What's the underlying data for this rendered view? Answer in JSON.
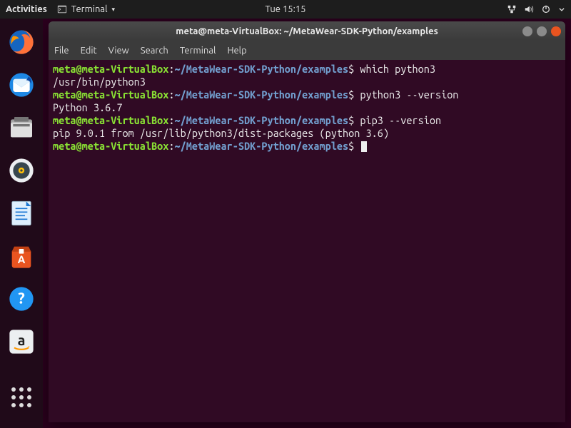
{
  "topbar": {
    "activities": "Activities",
    "appmenu_label": "Terminal",
    "appmenu_dropdown_glyph": "▾",
    "clock": "Tue 15:15"
  },
  "launcher": {
    "items": [
      {
        "name": "firefox"
      },
      {
        "name": "thunderbird"
      },
      {
        "name": "files"
      },
      {
        "name": "rhythmbox"
      },
      {
        "name": "libreoffice-writer"
      },
      {
        "name": "ubuntu-software"
      },
      {
        "name": "help"
      },
      {
        "name": "amazon"
      }
    ]
  },
  "window": {
    "title": "meta@meta-VirtualBox: ~/MetaWear-SDK-Python/examples",
    "menu": {
      "file": "File",
      "edit": "Edit",
      "view": "View",
      "search": "Search",
      "terminal": "Terminal",
      "help": "Help"
    }
  },
  "terminal": {
    "prompt_user": "meta@meta-VirtualBox",
    "prompt_sep": ":",
    "prompt_path": "~/MetaWear-SDK-Python/examples",
    "prompt_dollar": "$",
    "lines": [
      {
        "type": "prompt",
        "cmd": "which python3"
      },
      {
        "type": "output",
        "text": "/usr/bin/python3"
      },
      {
        "type": "prompt",
        "cmd": "python3 --version"
      },
      {
        "type": "output",
        "text": "Python 3.6.7"
      },
      {
        "type": "prompt",
        "cmd": "pip3 --version"
      },
      {
        "type": "output",
        "text": "pip 9.0.1 from /usr/lib/python3/dist-packages (python 3.6)"
      },
      {
        "type": "prompt",
        "cmd": "",
        "cursor": true
      }
    ]
  },
  "colors": {
    "term_bg": "#300a24",
    "prompt_user": "#8ae234",
    "prompt_path": "#729fcf",
    "close_button": "#e95420"
  }
}
